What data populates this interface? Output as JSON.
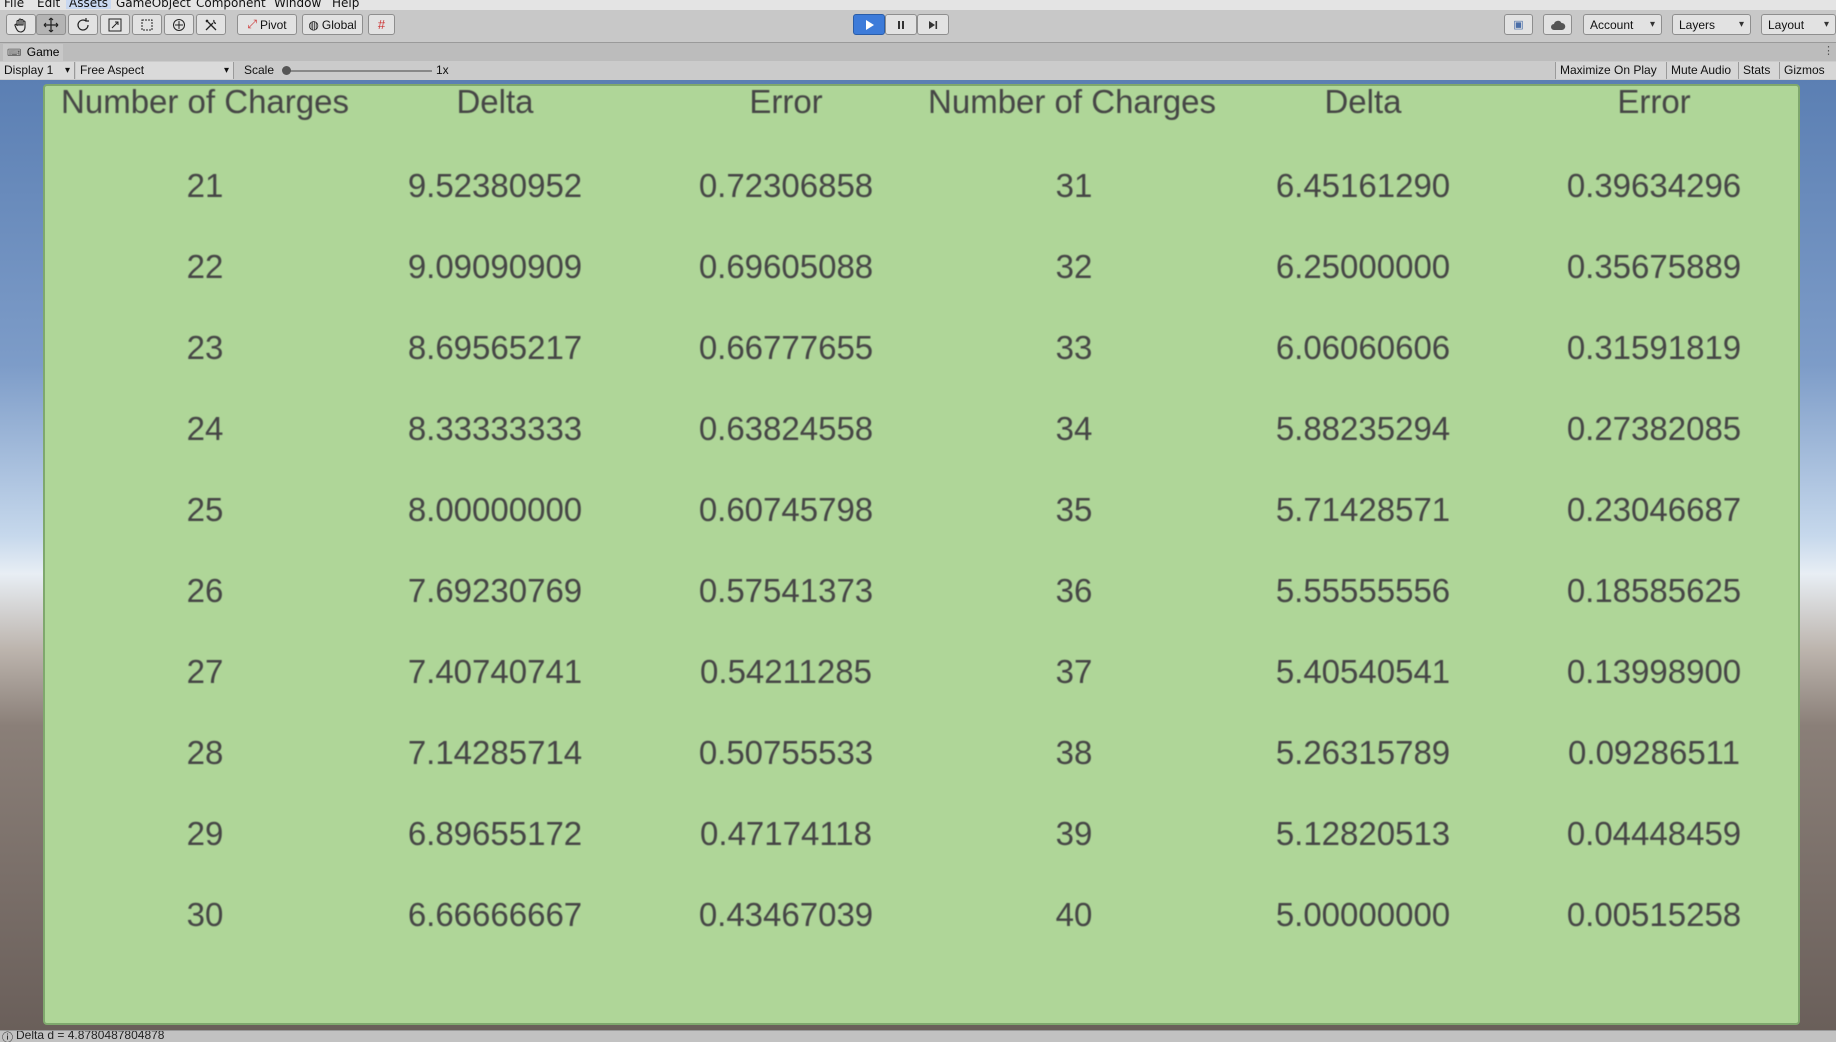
{
  "menu": [
    "File",
    "Edit",
    "Assets",
    "GameObject",
    "Component",
    "Window",
    "Help"
  ],
  "toolbar": {
    "tools": [
      "hand-tool",
      "move-tool",
      "rotate-tool",
      "scale-tool",
      "rect-tool",
      "transform-tool",
      "custom-tool"
    ],
    "pivot_label": "Pivot",
    "global_label": "Global",
    "account_label": "Account",
    "layers_label": "Layers",
    "layout_label": "Layout"
  },
  "tab": {
    "label": "Game"
  },
  "gamebar": {
    "display": "Display 1",
    "aspect": "Free Aspect",
    "scale_label": "Scale",
    "scale_value": "1x",
    "maximize": "Maximize On Play",
    "mute": "Mute Audio",
    "stats": "Stats",
    "gizmos": "Gizmos"
  },
  "table": {
    "headers": [
      "Number of Charges",
      "Delta",
      "Error",
      "Number of Charges",
      "Delta",
      "Error"
    ],
    "rows": [
      [
        "21",
        "9.52380952",
        "0.72306858",
        "31",
        "6.45161290",
        "0.39634296"
      ],
      [
        "22",
        "9.09090909",
        "0.69605088",
        "32",
        "6.25000000",
        "0.35675889"
      ],
      [
        "23",
        "8.69565217",
        "0.66777655",
        "33",
        "6.06060606",
        "0.31591819"
      ],
      [
        "24",
        "8.33333333",
        "0.63824558",
        "34",
        "5.88235294",
        "0.27382085"
      ],
      [
        "25",
        "8.00000000",
        "0.60745798",
        "35",
        "5.71428571",
        "0.23046687"
      ],
      [
        "26",
        "7.69230769",
        "0.57541373",
        "36",
        "5.55555556",
        "0.18585625"
      ],
      [
        "27",
        "7.40740741",
        "0.54211285",
        "37",
        "5.40540541",
        "0.13998900"
      ],
      [
        "28",
        "7.14285714",
        "0.50755533",
        "38",
        "5.26315789",
        "0.09286511"
      ],
      [
        "29",
        "6.89655172",
        "0.47174118",
        "39",
        "5.12820513",
        "0.04448459"
      ],
      [
        "30",
        "6.66666667",
        "0.43467039",
        "40",
        "5.00000000",
        "0.00515258"
      ]
    ]
  },
  "status": {
    "message": "Delta d = 4.8780487804878"
  }
}
